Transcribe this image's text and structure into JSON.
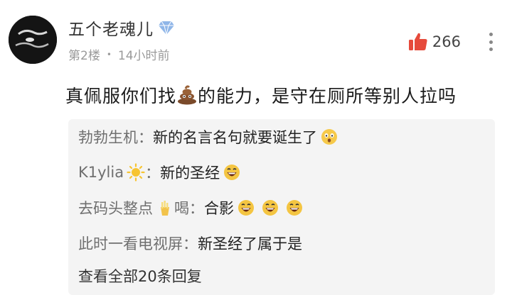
{
  "post": {
    "author": {
      "name": "五个老魂儿",
      "badge_icon": "verified-diamond-icon",
      "avatar_icon": "avatar-dark-icon"
    },
    "floor": "第2楼",
    "time": "14小时前",
    "likes": {
      "count": "266",
      "icon": "thumbs-up-icon",
      "color": "#e64a3b"
    },
    "more_icon": "more-vertical-icon",
    "comment": {
      "before": "真佩服你们找",
      "emoji": "poop-emoji",
      "after": "的能力，是守在厕所等别人拉吗"
    }
  },
  "replies": [
    {
      "name": "勃勃生机",
      "separator": "：",
      "text": "新的名言名句就要诞生了",
      "emojis": [
        "surprised-emoji"
      ]
    },
    {
      "name": "K1ylia",
      "name_emoji": "sun-emoji",
      "separator": "：",
      "text": "新的圣经",
      "emojis": [
        "grinning-emoji"
      ]
    },
    {
      "name": "去码头整点",
      "name_emoji": "fries-emoji",
      "name_suffix": "喝",
      "separator": "：",
      "text": "合影",
      "emojis": [
        "grinning-emoji",
        "grinning-emoji",
        "grinning-emoji"
      ]
    },
    {
      "name": "此时一看电视屏",
      "separator": "：",
      "text": "新圣经了属于是",
      "emojis": []
    }
  ],
  "view_all": "查看全部20条回复"
}
